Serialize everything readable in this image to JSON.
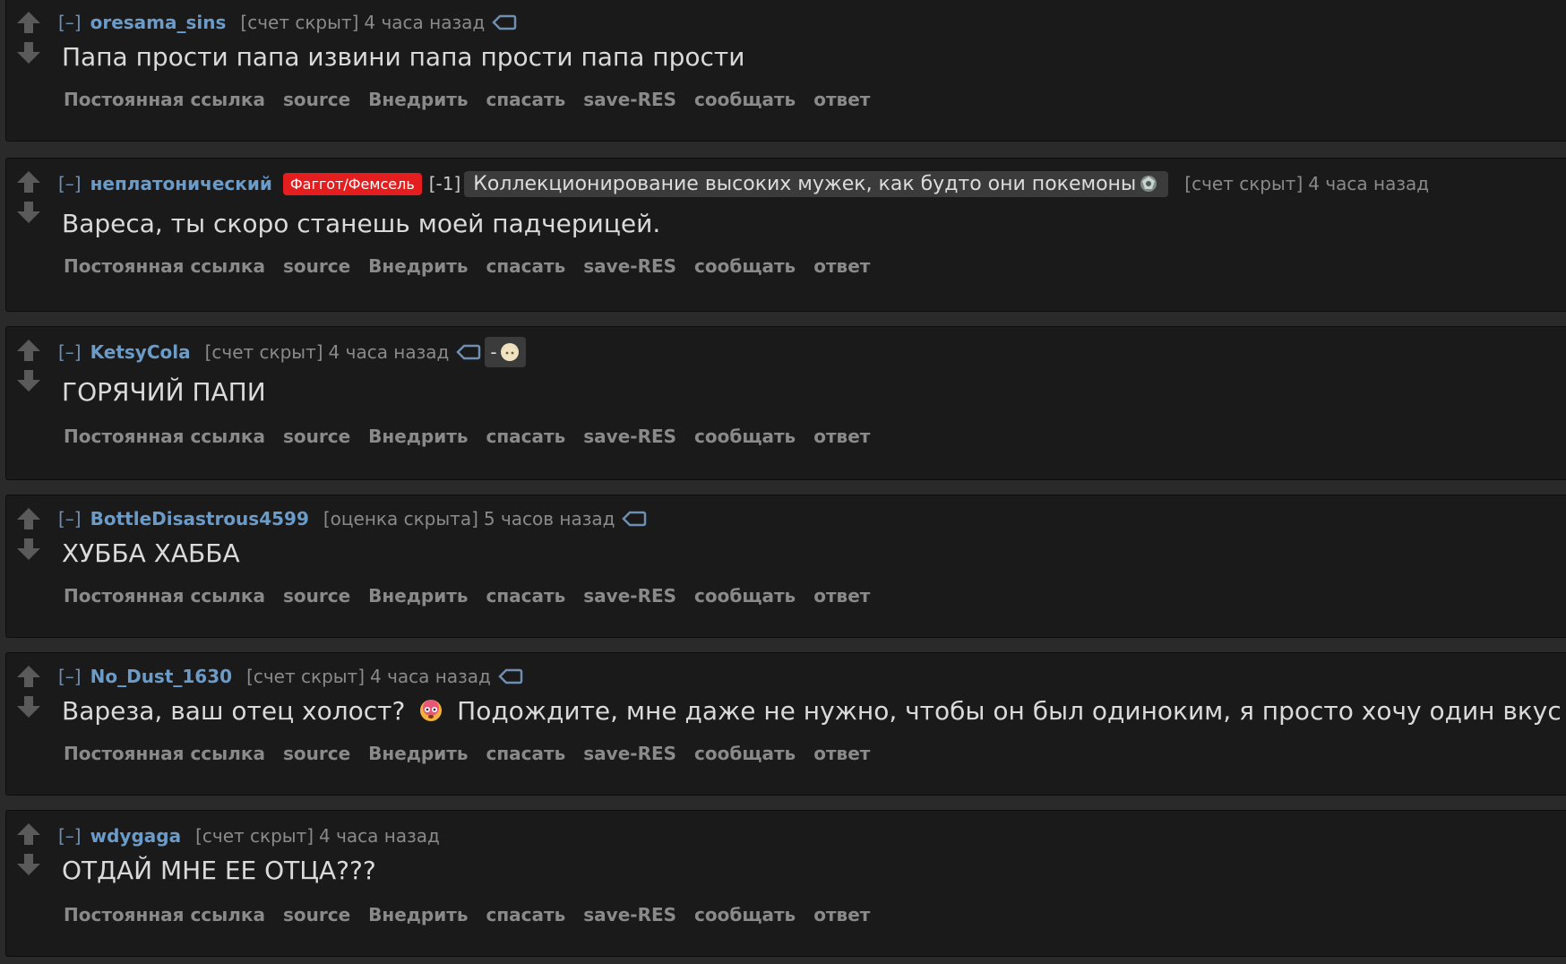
{
  "actions": {
    "permalink": "Постоянная ссылка",
    "source": "source",
    "embed": "Внедрить",
    "save": "спасать",
    "save_res": "save-RES",
    "report": "сообщать",
    "reply": "ответ"
  },
  "colors": {
    "background": "#1a1a1b",
    "author": "#6b9bc9",
    "flair_red": "#e41e1e",
    "flair_grey": "#3b3b3b"
  },
  "comments": [
    {
      "expand": "[–]",
      "author": "oresama_sins",
      "score": "[счет скрыт]",
      "time": "4 часа назад",
      "icon": "tag-icon",
      "body": "Папа прости папа извини папа прости папа прости"
    },
    {
      "expand": "[–]",
      "author": "неплатонический",
      "flair": "Фаггот/Фемсель",
      "vote_score": "[-1]",
      "user_flair": "Коллекционирование высоких мужек, как будто они покемоны",
      "score": "[счет скрыт]",
      "time": "4 часа назад",
      "body": "Вареса, ты скоро станешь моей падчерицей."
    },
    {
      "expand": "[–]",
      "author": "KetsyCola",
      "score": "[счет скрыт]",
      "time": "4 часа назад",
      "icon": "tag-icon",
      "flair_small": "-",
      "body": "ГОРЯЧИЙ ПАПИ"
    },
    {
      "expand": "[–]",
      "author": "BottleDisastrous4599",
      "score": "[оценка скрыта]",
      "time": "5 часов назад",
      "icon": "tag-icon",
      "body": "ХУББА ХАББА"
    },
    {
      "expand": "[–]",
      "author": "No_Dust_1630",
      "score": "[счет скрыт]",
      "time": "4 часа назад",
      "icon": "tag-icon",
      "body_a": "Вареза, ваш отец холост?",
      "body_b": "Подождите, мне даже не нужно, чтобы он был одиноким, я просто хочу один вкус"
    },
    {
      "expand": "[–]",
      "author": "wdygaga",
      "score": "[счет скрыт]",
      "time": "4 часа назад",
      "body": "ОТДАЙ МНЕ ЕЕ ОТЦА???"
    }
  ]
}
